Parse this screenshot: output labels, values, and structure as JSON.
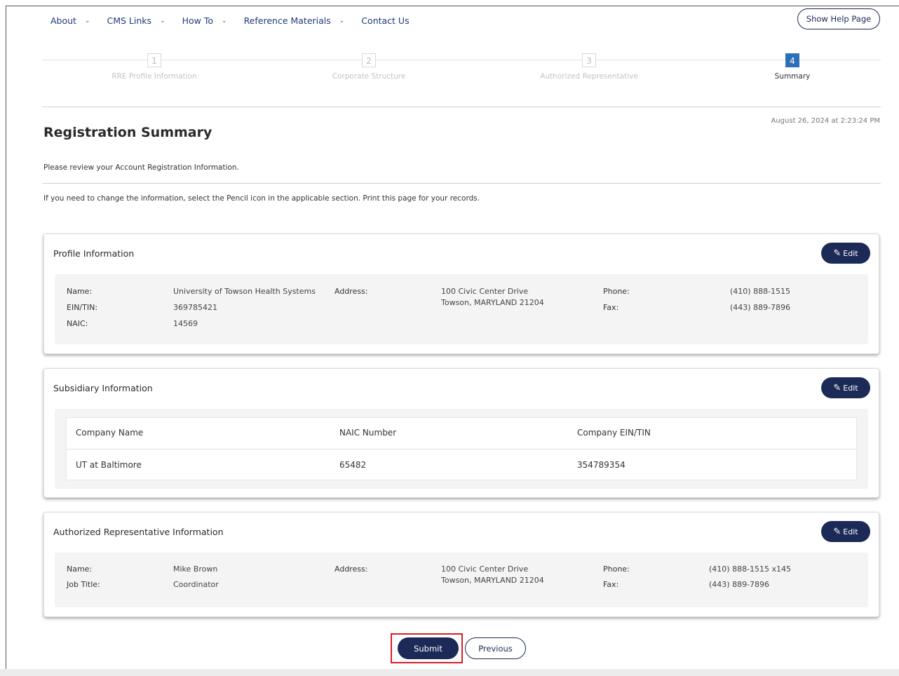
{
  "nav": {
    "items": [
      {
        "label": "About",
        "has_menu": true
      },
      {
        "label": "CMS Links",
        "has_menu": true
      },
      {
        "label": "How To",
        "has_menu": true
      },
      {
        "label": "Reference Materials",
        "has_menu": true
      },
      {
        "label": "Contact Us",
        "has_menu": false
      }
    ],
    "help_button": "Show Help Page"
  },
  "stepper": {
    "steps": [
      {
        "num": "1",
        "label": "RRE Profile Information"
      },
      {
        "num": "2",
        "label": "Corporate Structure"
      },
      {
        "num": "3",
        "label": "Authorized Representative"
      },
      {
        "num": "4",
        "label": "Summary"
      }
    ],
    "active_step": 4
  },
  "page": {
    "title": "Registration Summary",
    "timestamp": "August 26, 2024 at 2:23:24 PM",
    "intro1": "Please review your Account Registration Information.",
    "intro2": "If you need to change the information, select the Pencil icon in the applicable section. Print this page for your records."
  },
  "profile": {
    "title": "Profile Information",
    "edit_label": "Edit",
    "name_label": "Name:",
    "name": "University of Towson Health Systems",
    "ein_label": "EIN/TIN:",
    "ein": "369785421",
    "naic_label": "NAIC:",
    "naic": "14569",
    "address_label": "Address:",
    "address_line1": "100 Civic Center Drive",
    "address_line2": "Towson, MARYLAND 21204",
    "phone_label": "Phone:",
    "phone": "(410) 888-1515",
    "fax_label": "Fax:",
    "fax": "(443) 889-7896"
  },
  "subsidiary": {
    "title": "Subsidiary Information",
    "edit_label": "Edit",
    "columns": [
      "Company Name",
      "NAIC Number",
      "Company EIN/TIN"
    ],
    "rows": [
      [
        "UT at Baltimore",
        "65482",
        "354789354"
      ]
    ]
  },
  "representative": {
    "title": "Authorized Representative Information",
    "edit_label": "Edit",
    "name_label": "Name:",
    "name": "Mike Brown",
    "job_label": "Job Title:",
    "job": "Coordinator",
    "address_label": "Address:",
    "address_line1": "100 Civic Center Drive",
    "address_line2": "Towson, MARYLAND 21204",
    "phone_label": "Phone:",
    "phone": "(410) 888-1515 x145",
    "fax_label": "Fax:",
    "fax": "(443) 889-7896"
  },
  "actions": {
    "submit": "Submit",
    "previous": "Previous"
  },
  "colors": {
    "primary": "#1b2a57",
    "step_active": "#2c70b8",
    "highlight": "#d81e26"
  }
}
